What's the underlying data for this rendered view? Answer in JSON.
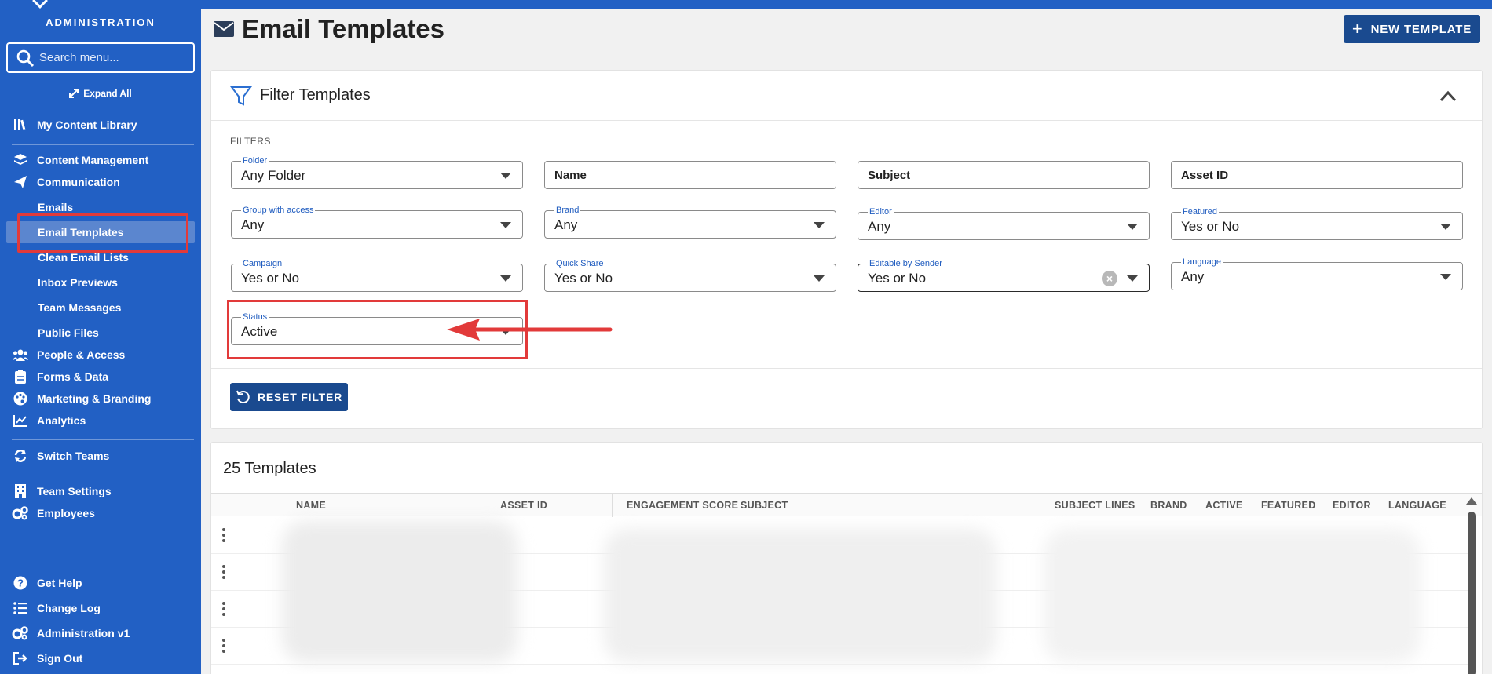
{
  "sidebar": {
    "title": "ADMINISTRATION",
    "search_placeholder": "Search menu...",
    "expand_all": "Expand All",
    "items": {
      "my_content_library": "My Content Library",
      "content_management": "Content Management",
      "communication": "Communication",
      "emails": "Emails",
      "email_templates": "Email Templates",
      "clean_email_lists": "Clean Email Lists",
      "inbox_previews": "Inbox Previews",
      "team_messages": "Team Messages",
      "public_files": "Public Files",
      "people_access": "People & Access",
      "forms_data": "Forms & Data",
      "marketing_branding": "Marketing & Branding",
      "analytics": "Analytics",
      "switch_teams": "Switch Teams",
      "team_settings": "Team Settings",
      "employees": "Employees",
      "get_help": "Get Help",
      "change_log": "Change Log",
      "administration_v1": "Administration v1",
      "sign_out": "Sign Out"
    },
    "selected_item": "Email Templates",
    "colors": {
      "bg": "#2260c4",
      "selected": "#5b86cf",
      "highlight": "#e23a3a"
    }
  },
  "header": {
    "title": "Email Templates",
    "new_template_label": "NEW TEMPLATE"
  },
  "filter": {
    "title": "Filter Templates",
    "filters_label": "FILTERS",
    "folder": {
      "label": "Folder",
      "value": "Any Folder"
    },
    "name": {
      "placeholder": "Name"
    },
    "subject": {
      "placeholder": "Subject"
    },
    "asset_id": {
      "placeholder": "Asset ID"
    },
    "group_with_access": {
      "label": "Group with access",
      "value": "Any"
    },
    "brand": {
      "label": "Brand",
      "value": "Any"
    },
    "editor": {
      "label": "Editor",
      "value": "Any"
    },
    "featured": {
      "label": "Featured",
      "value": "Yes or No"
    },
    "campaign": {
      "label": "Campaign",
      "value": "Yes or No"
    },
    "quick_share": {
      "label": "Quick Share",
      "value": "Yes or No"
    },
    "editable_by_sender": {
      "label": "Editable by Sender",
      "value": "Yes or No"
    },
    "language": {
      "label": "Language",
      "value": "Any"
    },
    "status": {
      "label": "Status",
      "value": "Active"
    },
    "reset_label": "RESET FILTER"
  },
  "templates": {
    "count_label": "25 Templates",
    "columns": [
      "NAME",
      "ASSET ID",
      "ENGAGEMENT SCORE",
      "SUBJECT",
      "SUBJECT LINES",
      "BRAND",
      "ACTIVE",
      "FEATURED",
      "EDITOR",
      "LANGUAGE"
    ]
  },
  "accent_color": "#1a4a8f"
}
